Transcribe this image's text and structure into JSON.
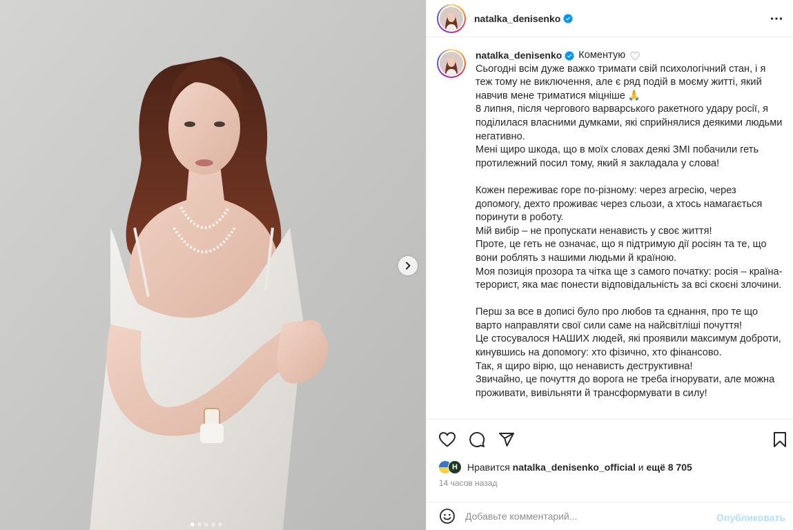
{
  "colors": {
    "accent": "#0095f6",
    "verified": "#0095f6",
    "muted": "#8e8e8e",
    "border": "#efefef"
  },
  "post": {
    "username": "natalka_denisenko",
    "carousel": {
      "slide_count": 5,
      "active_index": 0
    }
  },
  "icons": {
    "more": "more-horizontal-icon",
    "next": "chevron-right-icon",
    "verified": "verified-badge-icon",
    "like": "heart-icon",
    "comment": "comment-bubble-icon",
    "share": "paper-plane-icon",
    "save": "bookmark-icon",
    "emoji": "emoji-smile-icon"
  },
  "caption": {
    "username": "natalka_denisenko",
    "tag": "Коментую",
    "paragraphs": [
      "Сьогодні всім дуже важко тримати свій психологічний стан, і я теж тому не виключення, але є ряд подій в моєму житті, який навчив мене триматися міцніше 🙏",
      "8 липня, після чергового варварського ракетного удару росії, я поділилася власними думками, які сприйнялися деякими людьми негативно.",
      "Мені щиро шкода, що в моїх словах деякі ЗМІ побачили геть протилежний посил тому, який я закладала у слова!",
      "",
      "Кожен переживає горе по-різному: через агресію, через допомогу, дехто проживає через сльози, а хтось намагається поринути в роботу.",
      "Мій вибір – не пропускати ненависть у своє життя!",
      "Проте, це геть не означає, що я підтримую дії росіян та те, що вони роблять з нашими людьми й країною.",
      "Моя позиція прозора та чітка ще з самого початку: росія – країна-терорист, яка має понести відповідальність за всі скоєні злочини.",
      "",
      "Перш за все в дописі було про любов та єднання, про те що варто направляти свої сили саме на найсвітліші почуття!",
      "Це стосувалося НАШИХ людей, які проявили максимум доброти, кинувшись на допомогу: хто фізично, хто фінансово.",
      "Так, я щиро вірю, що ненависть деструктивна!",
      "Звичайно, це почуття до ворога не треба ігнорувати, але можна проживати, вивільняти й трансформувати в силу!"
    ]
  },
  "likes": {
    "prefix": "Нравится",
    "user": "natalka_denisenko_official",
    "conj": "и",
    "others": "ещё 8 705",
    "avatar_letter": "H"
  },
  "time": "14 часов назад",
  "comment": {
    "placeholder": "Добавьте комментарий...",
    "publish_label": "Опубликовать"
  }
}
